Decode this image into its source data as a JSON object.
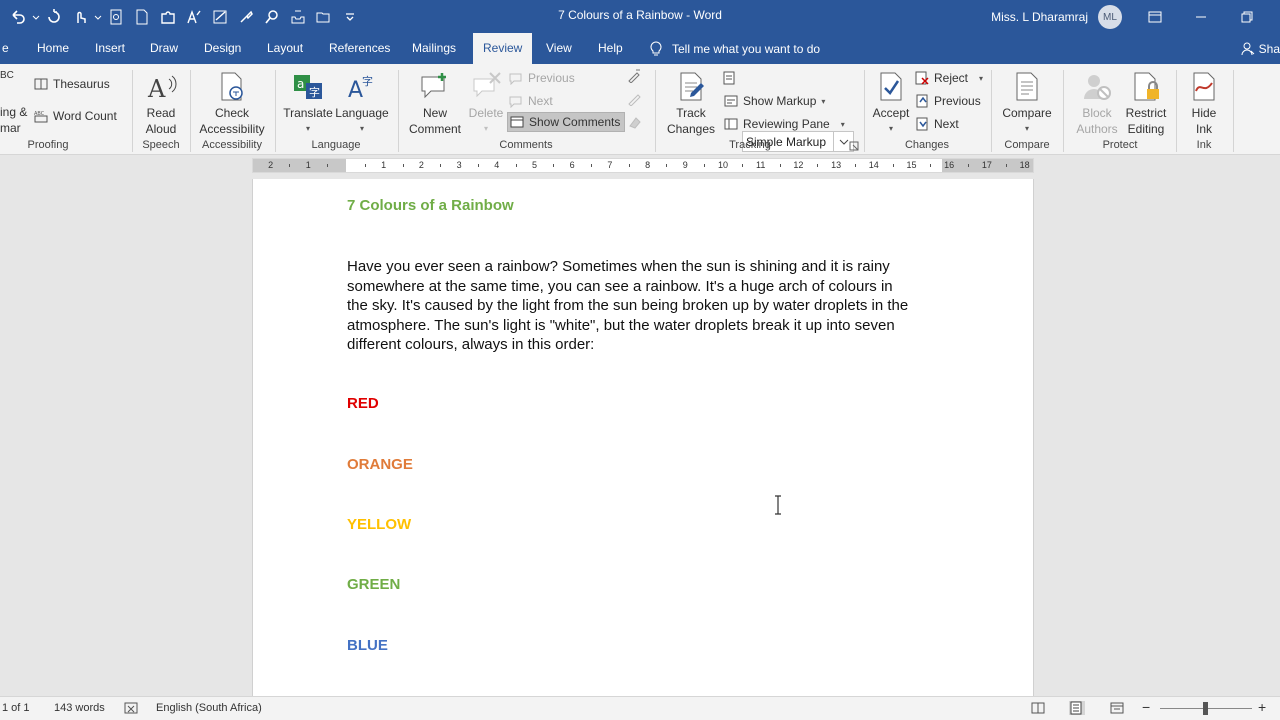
{
  "window": {
    "title": "7 Colours of a Rainbow  -  Word",
    "user_name": "Miss. L Dharamraj",
    "user_initials": "ML"
  },
  "tabs": [
    "Home",
    "Insert",
    "Draw",
    "Design",
    "Layout",
    "References",
    "Mailings",
    "Review",
    "View",
    "Help"
  ],
  "active_tab": "Review",
  "tell_me": "Tell me what you want to do",
  "share_label": "Sha",
  "ribbon": {
    "proofing": {
      "spelling_line1": "ing &",
      "spelling_line2": "mar",
      "abc": "BC",
      "thesaurus": "Thesaurus",
      "word_count": "Word Count",
      "group": "Proofing"
    },
    "speech": {
      "read_aloud_line1": "Read",
      "read_aloud_line2": "Aloud",
      "group": "Speech"
    },
    "accessibility": {
      "check_line1": "Check",
      "check_line2": "Accessibility",
      "group": "Accessibility"
    },
    "language": {
      "translate": "Translate",
      "language": "Language",
      "group": "Language"
    },
    "comments": {
      "new_line1": "New",
      "new_line2": "Comment",
      "delete": "Delete",
      "previous": "Previous",
      "next": "Next",
      "show_comments": "Show Comments",
      "group": "Comments"
    },
    "tracking": {
      "track_line1": "Track",
      "track_line2": "Changes",
      "markup_mode": "Simple Markup",
      "show_markup": "Show Markup",
      "reviewing_pane": "Reviewing Pane",
      "group": "Tracking"
    },
    "changes": {
      "accept": "Accept",
      "reject": "Reject",
      "previous": "Previous",
      "next": "Next",
      "group": "Changes"
    },
    "compare": {
      "compare": "Compare",
      "group": "Compare"
    },
    "protect": {
      "block_line1": "Block",
      "block_line2": "Authors",
      "restrict_line1": "Restrict",
      "restrict_line2": "Editing",
      "group": "Protect"
    },
    "ink": {
      "hide_line1": "Hide",
      "hide_line2": "Ink",
      "group": "Ink"
    }
  },
  "ruler_numbers": [
    "2",
    "1",
    "1",
    "2",
    "3",
    "4",
    "5",
    "6",
    "7",
    "8",
    "9",
    "10",
    "11",
    "12",
    "13",
    "14",
    "15",
    "16",
    "17",
    "18"
  ],
  "document": {
    "heading": "7 Colours of a Rainbow",
    "paragraph_lines": [
      "Have you ever seen a rainbow? Sometimes when the sun is shining and it is rainy",
      "somewhere at the same time, you can see a rainbow. It's a huge arch of colours in",
      "the sky. It's caused by the light from the sun being broken up by water droplets in the",
      "atmosphere. The sun's light is \"white\", but the water droplets break it up into seven",
      "different colours, always in this order:"
    ],
    "colours": [
      {
        "label": "RED",
        "color": "#e00000"
      },
      {
        "label": "ORANGE",
        "color": "#e07b39"
      },
      {
        "label": "YELLOW",
        "color": "#ffc000"
      },
      {
        "label": "GREEN",
        "color": "#70ad47"
      },
      {
        "label": "BLUE",
        "color": "#4472c4"
      }
    ],
    "heading_color": "#70ad47"
  },
  "status": {
    "page": "1 of 1",
    "words": "143 words",
    "language": "English (South Africa)"
  },
  "theme": {
    "accent": "#2b579a"
  }
}
